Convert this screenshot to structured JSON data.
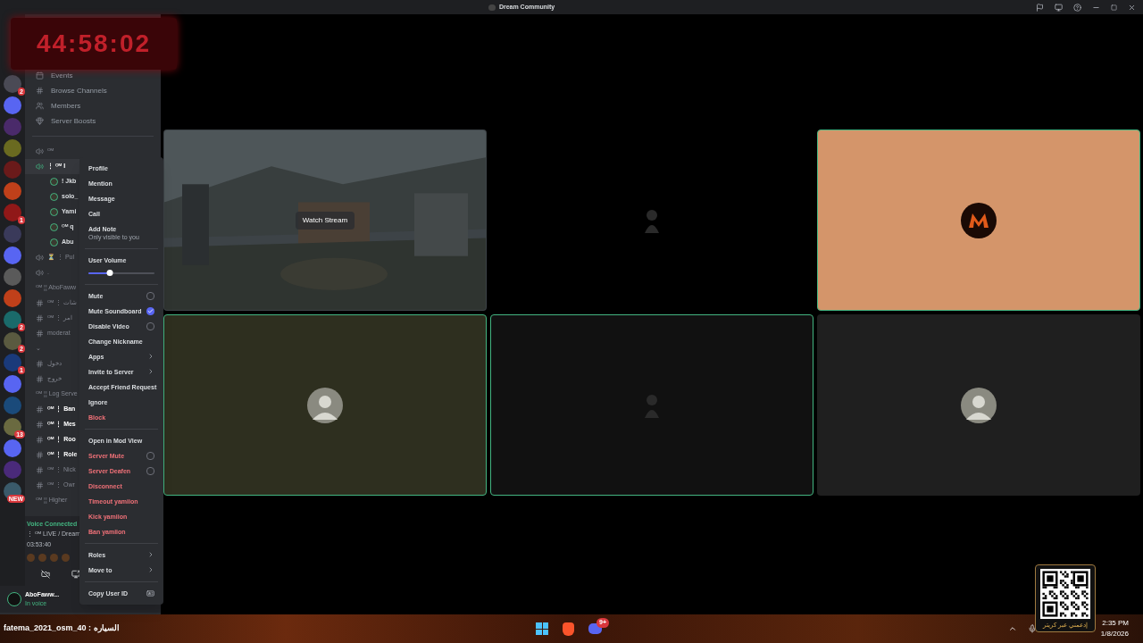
{
  "window": {
    "title": "Dream Community"
  },
  "timer": "44:58:02",
  "servers": [
    {
      "color": "#4a4a55",
      "badge": "2"
    },
    {
      "color": "#5865f2"
    },
    {
      "color": "#4a2a6a"
    },
    {
      "color": "#6a6a20"
    },
    {
      "color": "#6a1a1a"
    },
    {
      "color": "#c0401a"
    },
    {
      "color": "#901818",
      "badge": "1"
    },
    {
      "color": "#3a3a5a"
    },
    {
      "color": "#5865f2"
    },
    {
      "color": "#5a5a5a"
    },
    {
      "color": "#c0401a"
    },
    {
      "color": "#1a6a6a",
      "badge": "2"
    },
    {
      "color": "#5a5a40",
      "badge": "2"
    },
    {
      "color": "#1a3a7a",
      "badge": "1"
    },
    {
      "color": "#5865f2"
    },
    {
      "color": "#1a4a7a"
    },
    {
      "color": "#6a6a40",
      "badge": "13"
    },
    {
      "color": "#5865f2"
    },
    {
      "color": "#4a2a7a"
    },
    {
      "color": "#3a5a6a",
      "badge": "NEW"
    }
  ],
  "sidebar": {
    "items": [
      "Events",
      "Browse Channels",
      "Members",
      "Server Boosts"
    ],
    "channels": [
      {
        "kind": "voice",
        "label": "ᴼᴹ"
      },
      {
        "kind": "voice-active",
        "label": "⋮ ᴼᴹ I"
      },
      {
        "kind": "member",
        "label": "! Jkb"
      },
      {
        "kind": "member",
        "label": "solo_"
      },
      {
        "kind": "member",
        "label": "Yami"
      },
      {
        "kind": "member",
        "label": "ᴼᴹ q"
      },
      {
        "kind": "member",
        "label": "Abu"
      },
      {
        "kind": "voice",
        "label": "⏳ ⋮ Pul"
      },
      {
        "kind": "voice",
        "label": "."
      },
      {
        "kind": "category",
        "label": "ᴼᴹ ¦¦ AboFaww"
      },
      {
        "kind": "text",
        "label": "ᴼᴹ ⋮ شات"
      },
      {
        "kind": "text",
        "label": "ᴼᴹ ⋮ امر"
      },
      {
        "kind": "text",
        "label": "moderat"
      },
      {
        "kind": "category",
        "label": "⌄"
      },
      {
        "kind": "text",
        "label": "دخول"
      },
      {
        "kind": "text",
        "label": "خروج"
      },
      {
        "kind": "category",
        "label": "ᴼᴹ ¦¦ Log Serve"
      },
      {
        "kind": "text-bold",
        "label": "ᴼᴹ ⋮ Ban"
      },
      {
        "kind": "text-bold",
        "label": "ᴼᴹ ⋮ Mes"
      },
      {
        "kind": "text-bold",
        "label": "ᴼᴹ ⋮ Roo"
      },
      {
        "kind": "text-bold",
        "label": "ᴼᴹ ⋮ Role"
      },
      {
        "kind": "text",
        "label": "ᴼᴹ ⋮ Nick"
      },
      {
        "kind": "text",
        "label": "ᴼᴹ ⋮ Owr"
      },
      {
        "kind": "category",
        "label": "ᴼᴹ ¦¦ Higher"
      }
    ]
  },
  "voice": {
    "status": "Voice Connected",
    "channel": "⋮ ᴼᴹ LIVE / Dream",
    "time": "03:53:40"
  },
  "user": {
    "name": "AboFaww...",
    "status": "In voice"
  },
  "menu": [
    {
      "kind": "item",
      "label": "Profile",
      "danger": false
    },
    {
      "kind": "item",
      "label": "Mention",
      "danger": false
    },
    {
      "kind": "item",
      "label": "Message",
      "danger": false
    },
    {
      "kind": "item",
      "label": "Call",
      "danger": false
    },
    {
      "kind": "note",
      "label": "Add Note",
      "hint": "Only visible to you",
      "danger": false
    },
    {
      "kind": "divider"
    },
    {
      "kind": "slider",
      "label": "User Volume",
      "level": 0.32,
      "danger": false
    },
    {
      "kind": "divider"
    },
    {
      "kind": "checkbox",
      "label": "Mute",
      "checked": false,
      "danger": false
    },
    {
      "kind": "checkbox",
      "label": "Mute Soundboard",
      "checked": true,
      "danger": false
    },
    {
      "kind": "checkbox",
      "label": "Disable Video",
      "checked": false,
      "danger": false
    },
    {
      "kind": "item",
      "label": "Change Nickname",
      "danger": false
    },
    {
      "kind": "submenu",
      "label": "Apps",
      "danger": false
    },
    {
      "kind": "submenu",
      "label": "Invite to Server",
      "danger": false
    },
    {
      "kind": "item",
      "label": "Accept Friend Request",
      "danger": false
    },
    {
      "kind": "item",
      "label": "Ignore",
      "danger": false
    },
    {
      "kind": "item",
      "label": "Block",
      "danger": true
    },
    {
      "kind": "divider"
    },
    {
      "kind": "item",
      "label": "Open in Mod View",
      "danger": false
    },
    {
      "kind": "checkbox",
      "label": "Server Mute",
      "checked": false,
      "danger": true
    },
    {
      "kind": "checkbox",
      "label": "Server Deafen",
      "checked": false,
      "danger": true
    },
    {
      "kind": "item",
      "label": "Disconnect",
      "danger": true
    },
    {
      "kind": "item",
      "label": "Timeout yamiion",
      "danger": true
    },
    {
      "kind": "item",
      "label": "Kick yamiion",
      "danger": true
    },
    {
      "kind": "item",
      "label": "Ban yamiion",
      "danger": true
    },
    {
      "kind": "divider"
    },
    {
      "kind": "submenu",
      "label": "Roles",
      "danger": false
    },
    {
      "kind": "submenu",
      "label": "Move to",
      "danger": false
    },
    {
      "kind": "divider"
    },
    {
      "kind": "id",
      "label": "Copy User ID",
      "danger": false
    }
  ],
  "tiles": [
    {
      "kind": "stream",
      "button": "Watch Stream",
      "speaking": false
    },
    {
      "kind": "figure",
      "color": "#000000",
      "speaking": false
    },
    {
      "kind": "logo",
      "color": "#d4956a",
      "speaking": true
    },
    {
      "kind": "avatar",
      "color": "#2e2f1f",
      "speaking": true
    },
    {
      "kind": "figure",
      "color": "#111111",
      "speaking": true
    },
    {
      "kind": "avatar",
      "color": "#1f1f1f",
      "speaking": false
    }
  ],
  "qr": {
    "caption": "إدعمني عبر كريتر"
  },
  "stream_chat": "fatema_2021_osm_40 : السياره",
  "taskbar": {
    "discord_badge": "9+",
    "time": "2:35 PM",
    "date": "1/8/2026"
  }
}
